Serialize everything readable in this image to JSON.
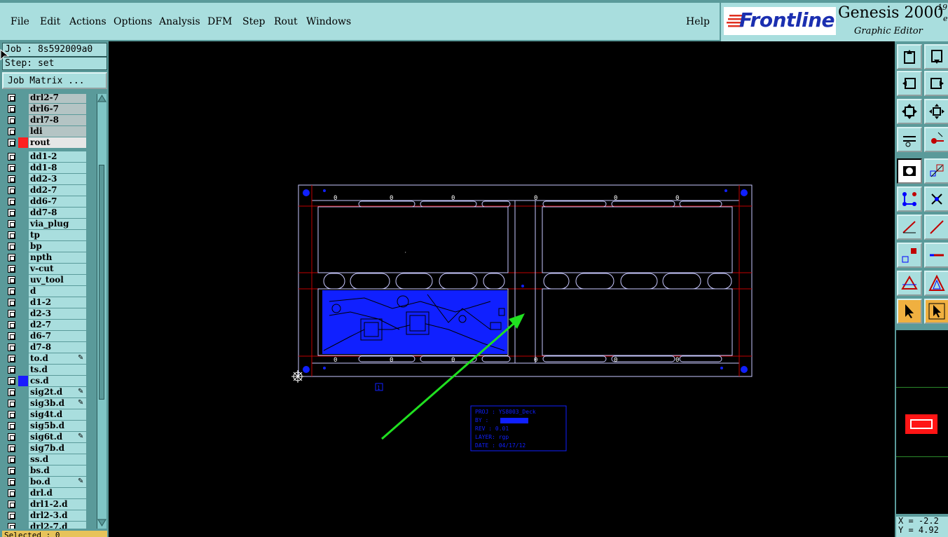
{
  "menubar": {
    "items": [
      "File",
      "Edit",
      "Actions",
      "Options",
      "Analysis",
      "DFM",
      "Step",
      "Rout",
      "Windows"
    ],
    "help": "Help"
  },
  "product": {
    "logo": "Frontline",
    "name": "Genesis 2000",
    "version_top": "19",
    "version_bottom": "e",
    "subtitle": "Graphic Editor"
  },
  "left_panel": {
    "job": "Job : 8s592009a0",
    "step": "Step: set",
    "job_matrix": "Job Matrix ...",
    "status": "Selected : 0"
  },
  "layers": [
    {
      "name": "drl2-7",
      "bg": "#b4c4c4",
      "color": "",
      "affected": false
    },
    {
      "name": "drl6-7",
      "bg": "#b4c4c4",
      "color": "",
      "affected": false
    },
    {
      "name": "drl7-8",
      "bg": "#b4c4c4",
      "color": "",
      "affected": false
    },
    {
      "name": "ldi",
      "bg": "#b4c4c4",
      "color": "",
      "affected": false
    },
    {
      "name": "rout",
      "bg": "#e6e6e6",
      "color": "#ff2020",
      "affected": false
    },
    {
      "name": "dd1-2",
      "bg": "#a9dede",
      "color": "",
      "affected": false
    },
    {
      "name": "dd1-8",
      "bg": "#a9dede",
      "color": "",
      "affected": false
    },
    {
      "name": "dd2-3",
      "bg": "#a9dede",
      "color": "",
      "affected": false
    },
    {
      "name": "dd2-7",
      "bg": "#a9dede",
      "color": "",
      "affected": false
    },
    {
      "name": "dd6-7",
      "bg": "#a9dede",
      "color": "",
      "affected": false
    },
    {
      "name": "dd7-8",
      "bg": "#a9dede",
      "color": "",
      "affected": false
    },
    {
      "name": "via_plug",
      "bg": "#a9dede",
      "color": "",
      "affected": false
    },
    {
      "name": "tp",
      "bg": "#a9dede",
      "color": "",
      "affected": false
    },
    {
      "name": "bp",
      "bg": "#a9dede",
      "color": "",
      "affected": false
    },
    {
      "name": "npth",
      "bg": "#a9dede",
      "color": "",
      "affected": false
    },
    {
      "name": "v-cut",
      "bg": "#a9dede",
      "color": "",
      "affected": false
    },
    {
      "name": "uv_tool",
      "bg": "#a9dede",
      "color": "",
      "affected": false
    },
    {
      "name": "d",
      "bg": "#a9dede",
      "color": "",
      "affected": false
    },
    {
      "name": "d1-2",
      "bg": "#a9dede",
      "color": "",
      "affected": false
    },
    {
      "name": "d2-3",
      "bg": "#a9dede",
      "color": "",
      "affected": false
    },
    {
      "name": "d2-7",
      "bg": "#a9dede",
      "color": "",
      "affected": false
    },
    {
      "name": "d6-7",
      "bg": "#a9dede",
      "color": "",
      "affected": false
    },
    {
      "name": "d7-8",
      "bg": "#a9dede",
      "color": "",
      "affected": false
    },
    {
      "name": "to.d",
      "bg": "#a9dede",
      "color": "",
      "affected": true
    },
    {
      "name": "ts.d",
      "bg": "#a9dede",
      "color": "",
      "affected": false
    },
    {
      "name": "cs.d",
      "bg": "#a9dede",
      "color": "#1a1aff",
      "affected": false
    },
    {
      "name": "sig2t.d",
      "bg": "#a9dede",
      "color": "",
      "affected": true
    },
    {
      "name": "sig3b.d",
      "bg": "#a9dede",
      "color": "",
      "affected": true
    },
    {
      "name": "sig4t.d",
      "bg": "#a9dede",
      "color": "",
      "affected": false
    },
    {
      "name": "sig5b.d",
      "bg": "#a9dede",
      "color": "",
      "affected": false
    },
    {
      "name": "sig6t.d",
      "bg": "#a9dede",
      "color": "",
      "affected": true
    },
    {
      "name": "sig7b.d",
      "bg": "#a9dede",
      "color": "",
      "affected": false
    },
    {
      "name": "ss.d",
      "bg": "#a9dede",
      "color": "",
      "affected": false
    },
    {
      "name": "bs.d",
      "bg": "#a9dede",
      "color": "",
      "affected": false
    },
    {
      "name": "bo.d",
      "bg": "#a9dede",
      "color": "",
      "affected": true
    },
    {
      "name": "drl.d",
      "bg": "#a9dede",
      "color": "",
      "affected": false
    },
    {
      "name": "drl1-2.d",
      "bg": "#a9dede",
      "color": "",
      "affected": false
    },
    {
      "name": "drl2-3.d",
      "bg": "#a9dede",
      "color": "",
      "affected": false
    },
    {
      "name": "drl2-7.d",
      "bg": "#a9dede",
      "color": "",
      "affected": false
    }
  ],
  "canvas": {
    "title_block": [
      "PROJ : YS8003_Deck",
      "BY   :",
      "REV  : 0.01",
      "LAYER: rgp",
      "DATE : 04/17/12"
    ],
    "panel_number": "1",
    "tab_label": "0",
    "colors": {
      "outline": "#c8c8ff",
      "route": "#c00000",
      "copper": "#1020ff",
      "arrow": "#20e020"
    }
  },
  "coords": {
    "x": "X = -2.2",
    "y": "Y = 4.92"
  },
  "toolbar_icons": [
    "zoom-in-top-icon",
    "zoom-in-bottom-icon",
    "pan-left-icon",
    "pan-right-icon",
    "fit-screen-icon",
    "zoom-center-icon",
    "settings-icon",
    "measure-icon",
    "select-feature-icon",
    "edit-shape-icon",
    "connect-icon",
    "delete-icon",
    "line-angle-icon",
    "line-icon",
    "pad-icon",
    "line-segment-icon",
    "triangle-icon",
    "triangle-select-icon",
    "pointer-icon",
    "pointer-select-icon"
  ]
}
